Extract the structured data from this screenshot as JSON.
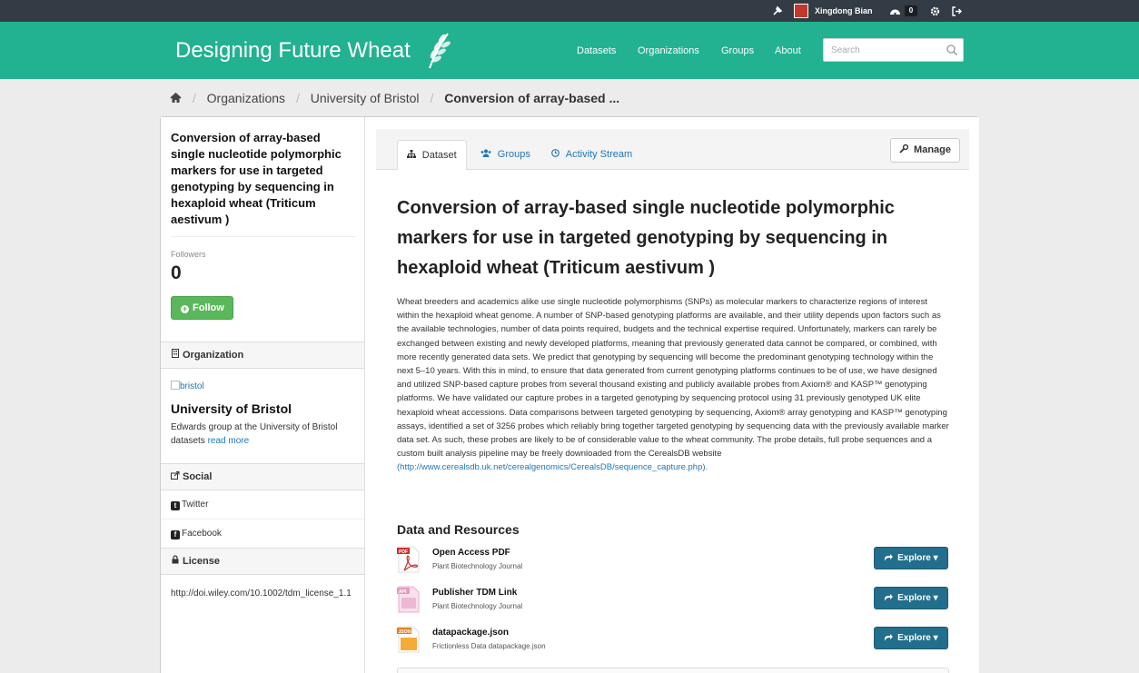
{
  "account": {
    "user_name": "Xingdong Bian",
    "dashboard_count": "0"
  },
  "masthead": {
    "brand": "Designing Future Wheat"
  },
  "nav": {
    "items": [
      "Datasets",
      "Organizations",
      "Groups",
      "About"
    ]
  },
  "search": {
    "placeholder": "Search"
  },
  "breadcrumb": {
    "items": [
      "Organizations",
      "University of Bristol"
    ],
    "active": "Conversion of array-based ..."
  },
  "sidebar": {
    "title": "Conversion of array-based single nucleotide polymorphic markers for use in targeted genotyping by sequencing in hexaploid wheat (Triticum aestivum )",
    "followers_label": "Followers",
    "followers_count": "0",
    "follow_label": "Follow",
    "organization_heading": "Organization",
    "org_image_alt": "bristol",
    "org_name": "University of Bristol",
    "org_description": "Edwards group at the University of Bristol datasets",
    "read_more": "read more",
    "social_heading": "Social",
    "social_items": [
      "Twitter",
      "Facebook"
    ],
    "license_heading": "License",
    "license_text": "http://doi.wiley.com/10.1002/tdm_license_1.1"
  },
  "tabs": {
    "items": [
      "Dataset",
      "Groups",
      "Activity Stream"
    ],
    "manage": "Manage"
  },
  "dataset": {
    "title": "Conversion of array-based single nucleotide polymorphic markers for use in targeted genotyping by sequencing in hexaploid wheat (Triticum aestivum )",
    "notes": "Wheat breeders and academics alike use single nucleotide polymorphisms (SNPs) as molecular markers to characterize regions of interest within the hexaploid wheat genome. A number of SNP-based genotyping platforms are available, and their utility depends upon factors such as the available technologies, number of data points required, budgets and the technical expertise required. Unfortunately, markers can rarely be exchanged between existing and newly developed platforms, meaning that previously generated data cannot be compared, or combined, with more recently generated data sets. We predict that genotyping by sequencing will become the predominant genotyping technology within the next 5–10 years. With this in mind, to ensure that data generated from current genotyping platforms continues to be of use, we have designed and utilized SNP-based capture probes from several thousand existing and publicly available probes from Axiom® and KASP™ genotyping platforms. We have validated our capture probes in a targeted genotyping by sequencing protocol using 31 previously genotyped UK elite hexaploid wheat accessions. Data comparisons between targeted genotyping by sequencing, Axiom® array genotyping and KASP™ genotyping assays, identified a set of 3256 probes which reliably bring together targeted genotyping by sequencing data with the previously available marker data set. As such, these probes are likely to be of considerable value to the wheat community. The probe details, full probe sequences and a custom built analysis pipeline may be freely downloaded from the CerealsDB website",
    "notes_link": "(http://www.cerealsdb.uk.net/cerealgenomics/CerealsDB/sequence_capture.php).",
    "resources_heading": "Data and Resources",
    "resources": [
      {
        "title": "Open Access PDF",
        "description": "Plant Biotechnology Journal",
        "icon": "pdf-icon",
        "format": "PDF",
        "button": "Explore"
      },
      {
        "title": "Publisher TDM Link",
        "description": "Plant Biotechnology Journal",
        "icon": "api-icon",
        "format": "API",
        "button": "Explore"
      },
      {
        "title": "datapackage.json",
        "description": "Frictionless Data datapackage.json",
        "icon": "json-icon",
        "format": "JSON",
        "button": "Explore"
      }
    ]
  },
  "colors": {
    "masthead": "#22b191",
    "account_bar": "#333b44",
    "follow": "#5bb75b",
    "explore": "#226e8d",
    "link": "#1f76b5"
  }
}
